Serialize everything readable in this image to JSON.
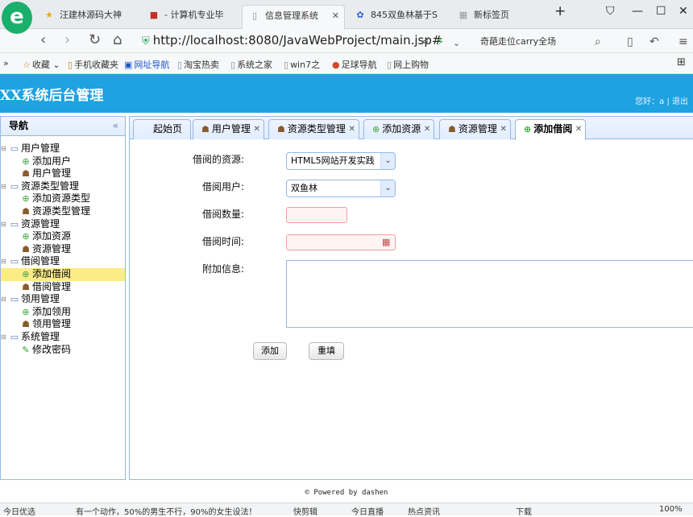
{
  "browser": {
    "logo_letter": "e",
    "tabs": [
      {
        "label": "汪建林源码大神",
        "icon": "★"
      },
      {
        "label": "- 计算机专业毕",
        "icon": "■"
      },
      {
        "label": "信息管理系统",
        "icon": "▯"
      },
      {
        "label": "845双鱼林基于S",
        "icon": "✿"
      },
      {
        "label": "新标签页",
        "icon": "▦"
      }
    ],
    "new_tab": "+",
    "url": "http://localhost:8080/JavaWebProject/main.jsp#",
    "search_text": "奇葩走位carry全场",
    "bookmarks": [
      "收藏",
      "手机收藏夹",
      "网址导航",
      "淘宝热卖",
      "系统之家",
      "win7之",
      "足球导航",
      "网上购物"
    ]
  },
  "app": {
    "title": "XX系统后台管理",
    "user_info": "您好：a | 退出"
  },
  "sidebar": {
    "title": "导航",
    "collapse": "«",
    "groups": [
      {
        "label": "用户管理",
        "children": [
          {
            "label": "添加用户",
            "icon": "add"
          },
          {
            "label": "用户管理",
            "icon": "user"
          }
        ]
      },
      {
        "label": "资源类型管理",
        "children": [
          {
            "label": "添加资源类型",
            "icon": "add"
          },
          {
            "label": "资源类型管理",
            "icon": "user"
          }
        ]
      },
      {
        "label": "资源管理",
        "children": [
          {
            "label": "添加资源",
            "icon": "add"
          },
          {
            "label": "资源管理",
            "icon": "user"
          }
        ]
      },
      {
        "label": "借阅管理",
        "children": [
          {
            "label": "添加借阅",
            "icon": "add",
            "selected": true
          },
          {
            "label": "借阅管理",
            "icon": "user"
          }
        ]
      },
      {
        "label": "领用管理",
        "children": [
          {
            "label": "添加领用",
            "icon": "add"
          },
          {
            "label": "领用管理",
            "icon": "user"
          }
        ]
      },
      {
        "label": "系统管理",
        "children": [
          {
            "label": "修改密码",
            "icon": "pencil"
          }
        ]
      }
    ]
  },
  "tabs": [
    {
      "label": "起始页",
      "closable": false
    },
    {
      "label": "用户管理",
      "closable": true
    },
    {
      "label": "资源类型管理",
      "closable": true
    },
    {
      "label": "添加资源",
      "closable": true
    },
    {
      "label": "资源管理",
      "closable": true
    },
    {
      "label": "添加借阅",
      "closable": true,
      "active": true
    }
  ],
  "form": {
    "resource_label": "借阅的资源:",
    "resource_value": "HTML5网站开发实践",
    "user_label": "借阅用户:",
    "user_value": "双鱼林",
    "count_label": "借阅数量:",
    "time_label": "借阅时间:",
    "extra_label": "附加信息:",
    "add_button": "添加",
    "reset_button": "重填"
  },
  "footer": "© Powered by dashen",
  "statusbar": [
    "今日优选",
    "有一个动作，50%的男生不行，90%的女生设法！",
    "快剪辑",
    "今日直播",
    "热点资讯",
    "下载",
    "100%"
  ]
}
